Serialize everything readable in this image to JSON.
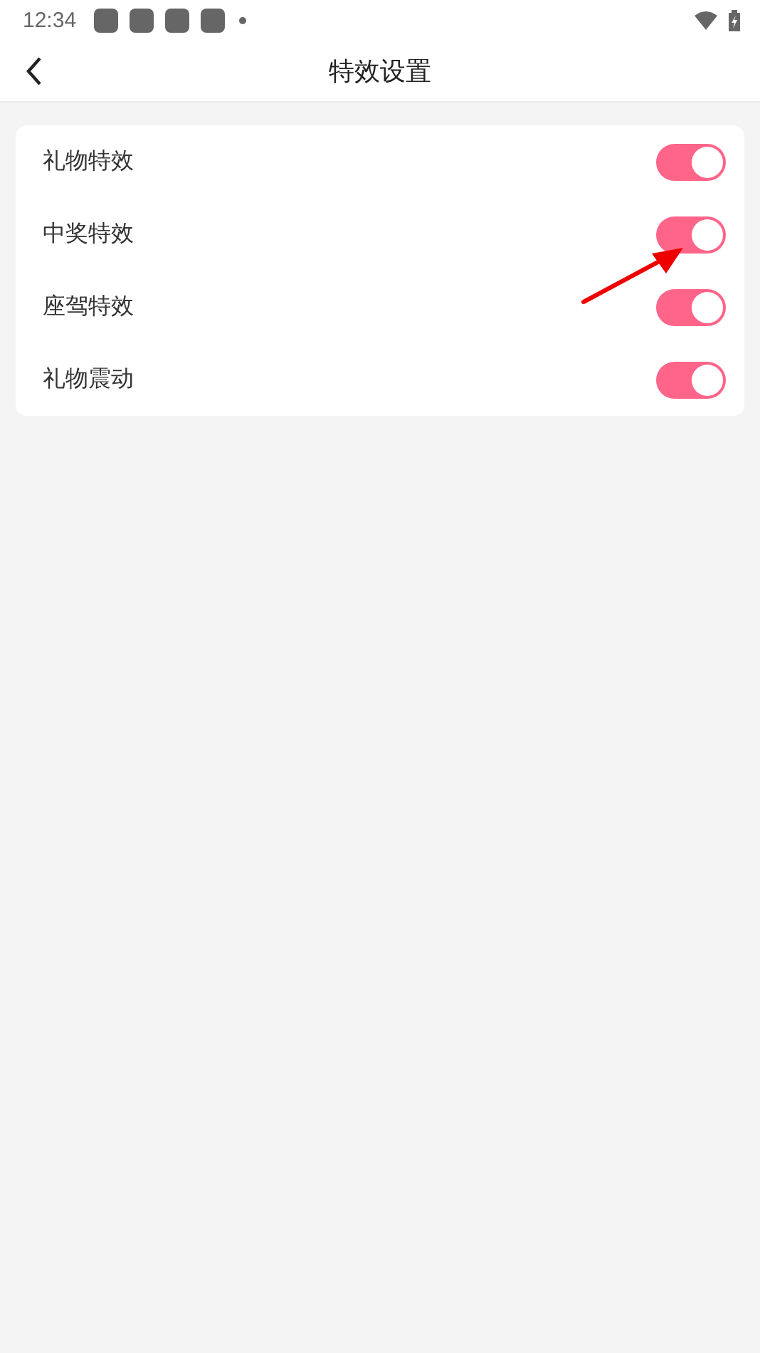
{
  "status_bar": {
    "time": "12:34"
  },
  "header": {
    "title": "特效设置"
  },
  "settings": [
    {
      "label": "礼物特效",
      "on": true
    },
    {
      "label": "中奖特效",
      "on": true
    },
    {
      "label": "座驾特效",
      "on": true
    },
    {
      "label": "礼物震动",
      "on": true
    }
  ]
}
